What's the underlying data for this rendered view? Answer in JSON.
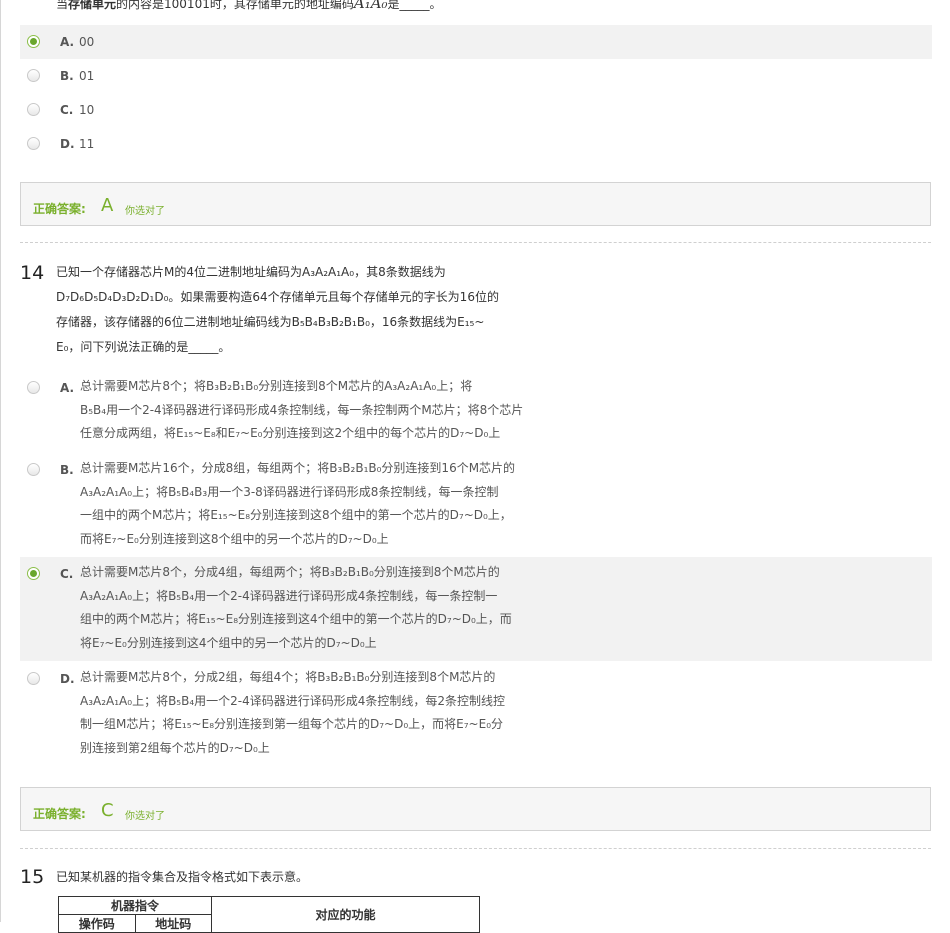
{
  "q13": {
    "stem_partial_prefix": "当",
    "stem_partial_bold": "存储单元",
    "stem_partial_rest": "的内容是100101时，其存储单元的地址编码",
    "stem_partial_math": "A₁A₀",
    "stem_partial_end": "是_____。",
    "options": [
      {
        "letter": "A.",
        "text": "00",
        "selected": true
      },
      {
        "letter": "B.",
        "text": "01",
        "selected": false
      },
      {
        "letter": "C.",
        "text": "10",
        "selected": false
      },
      {
        "letter": "D.",
        "text": "11",
        "selected": false
      }
    ],
    "answer": {
      "label": "正确答案:",
      "value": "A",
      "feedback": "你选对了"
    }
  },
  "q14": {
    "number": "14",
    "stem": [
      "已知一个存储器芯片M的4位二进制地址编码为A₃A₂A₁A₀，其8条数据线为",
      "D₇D₆D₅D₄D₃D₂D₁D₀。如果需要构造64个存储单元且每个存储单元的字长为16位的",
      "存储器，该存储器的6位二进制地址编码线为B₅B₄B₃B₂B₁B₀，16条数据线为E₁₅~",
      "E₀，问下列说法正确的是_____。"
    ],
    "options": [
      {
        "letter": "A.",
        "selected": false,
        "lines": [
          "总计需要M芯片8个；将B₃B₂B₁B₀分别连接到8个M芯片的A₃A₂A₁A₀上；将",
          "B₅B₄用一个2-4译码器进行译码形成4条控制线，每一条控制两个M芯片；将8个芯片",
          "任意分成两组，将E₁₅~E₈和E₇~E₀分别连接到这2个组中的每个芯片的D₇~D₀上"
        ]
      },
      {
        "letter": "B.",
        "selected": false,
        "lines": [
          "总计需要M芯片16个，分成8组，每组两个；将B₃B₂B₁B₀分别连接到16个M芯片的",
          "A₃A₂A₁A₀上；将B₅B₄B₃用一个3-8译码器进行译码形成8条控制线，每一条控制",
          "一组中的两个M芯片；将E₁₅~E₈分别连接到这8个组中的第一个芯片的D₇~D₀上，",
          "而将E₇~E₀分别连接到这8个组中的另一个芯片的D₇~D₀上"
        ]
      },
      {
        "letter": "C.",
        "selected": true,
        "lines": [
          "总计需要M芯片8个，分成4组，每组两个；将B₃B₂B₁B₀分别连接到8个M芯片的",
          "A₃A₂A₁A₀上；将B₅B₄用一个2-4译码器进行译码形成4条控制线，每一条控制一",
          "组中的两个M芯片；将E₁₅~E₈分别连接到这4个组中的第一个芯片的D₇~D₀上，而",
          "将E₇~E₀分别连接到这4个组中的另一个芯片的D₇~D₀上"
        ]
      },
      {
        "letter": "D.",
        "selected": false,
        "lines": [
          "总计需要M芯片8个，分成2组，每组4个；将B₃B₂B₁B₀分别连接到8个M芯片的",
          "A₃A₂A₁A₀上；将B₅B₄用一个2-4译码器进行译码形成4条控制线，每2条控制线控",
          "制一组M芯片；将E₁₅~E₈分别连接到第一组每个芯片的D₇~D₀上，而将E₇~E₀分",
          "别连接到第2组每个芯片的D₇~D₀上"
        ]
      }
    ],
    "answer": {
      "label": "正确答案:",
      "value": "C",
      "feedback": "你选对了"
    }
  },
  "q15": {
    "number": "15",
    "stem": "已知某机器的指令集合及指令格式如下表示意。",
    "table": {
      "group_header": "机器指令",
      "sub_headers": [
        "操作码",
        "地址码"
      ],
      "function_header": "对应的功能"
    }
  }
}
